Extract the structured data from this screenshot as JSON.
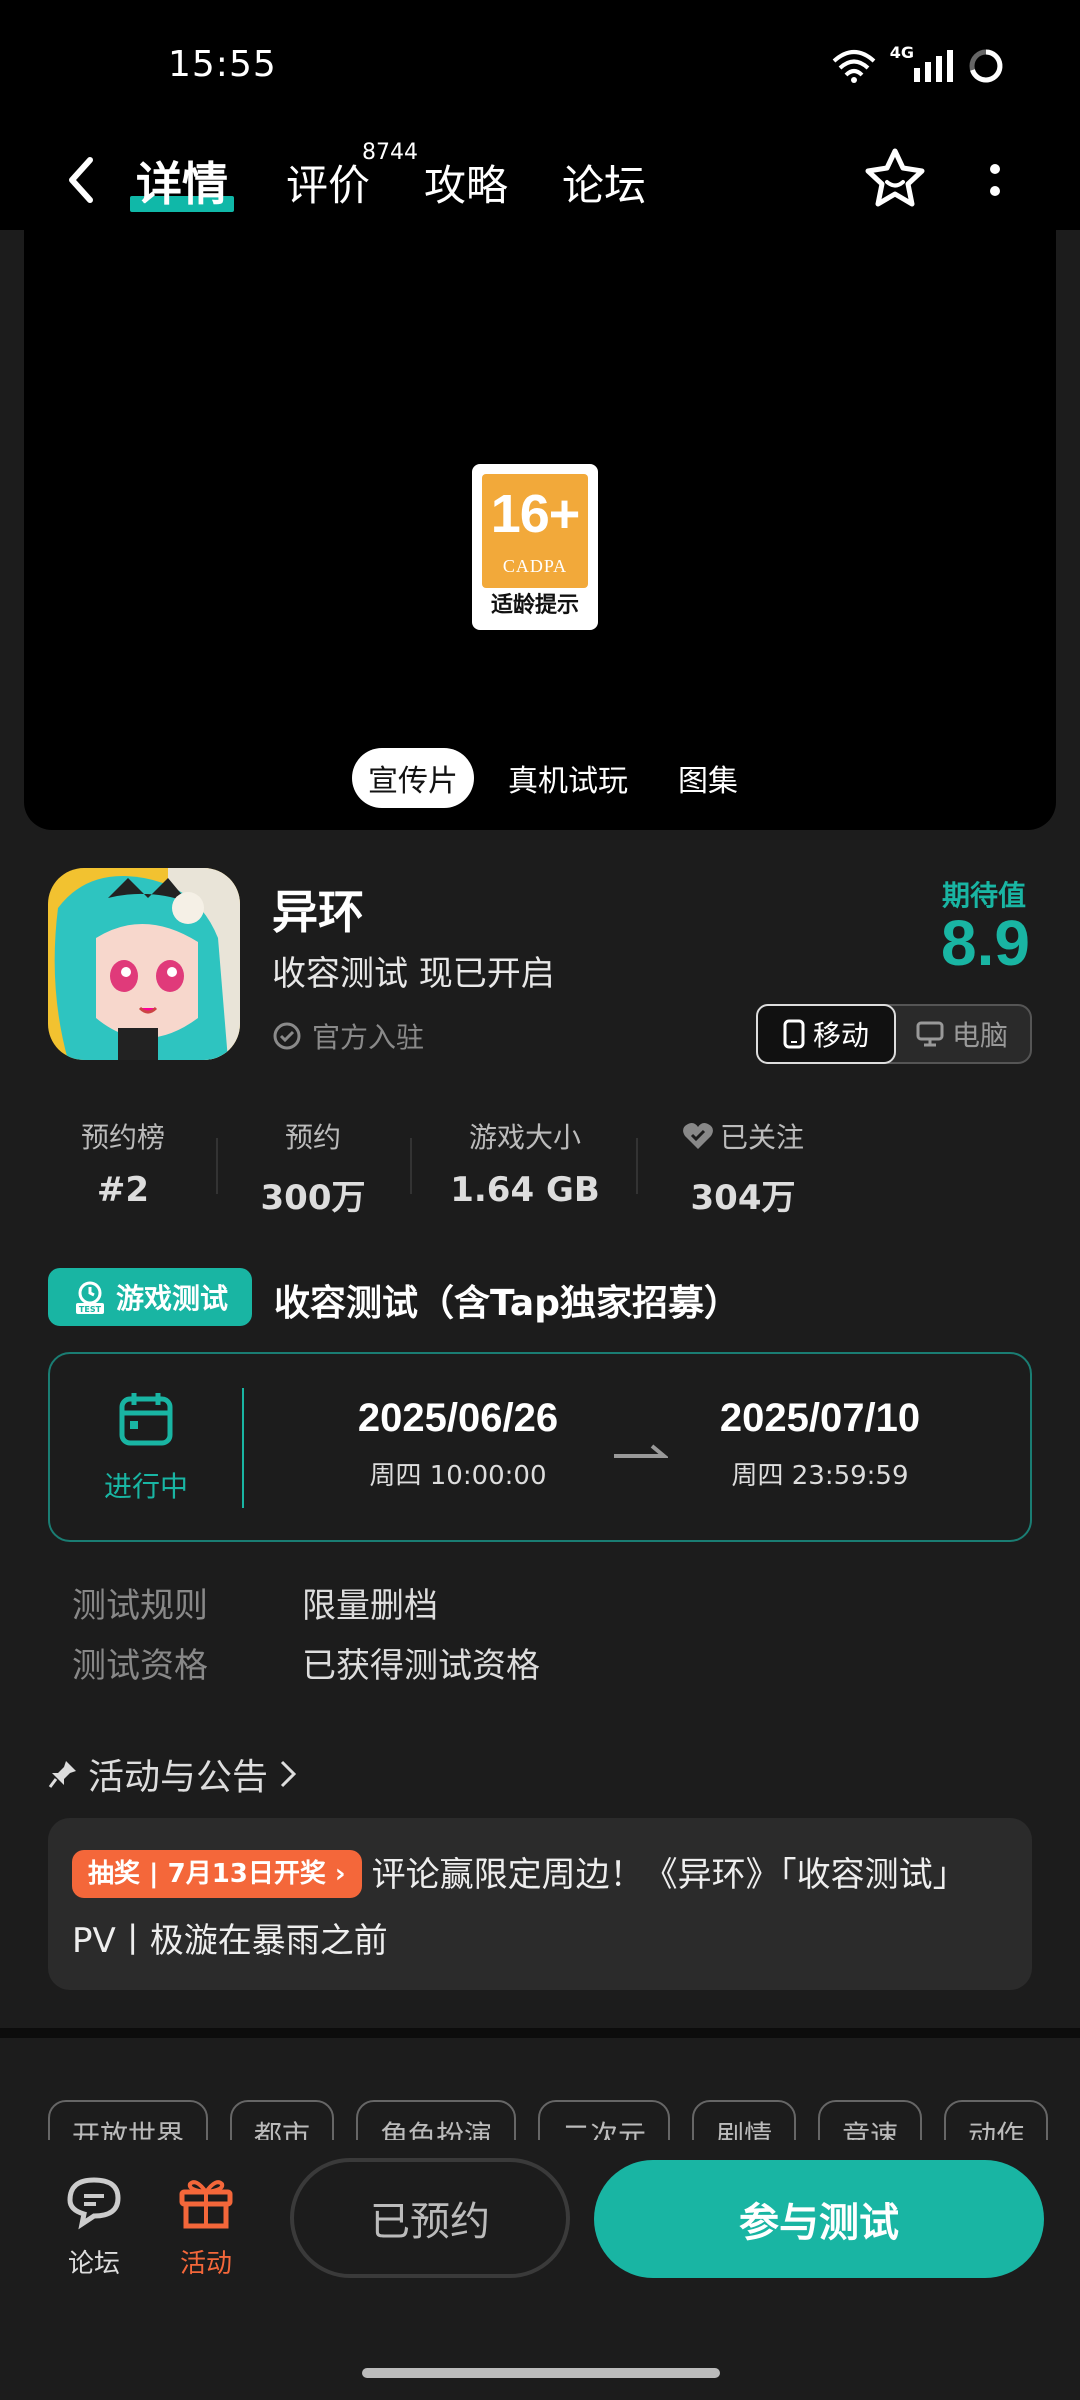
{
  "status": {
    "time": "15:55",
    "network": "4G"
  },
  "nav": {
    "tabs": {
      "details": "详情",
      "reviews": "评价",
      "guides": "攻略",
      "forum": "论坛"
    },
    "reviews_count": "8744"
  },
  "hero": {
    "age_badge": {
      "age": "16+",
      "org": "CADPA",
      "label": "适龄提示"
    },
    "media_tabs": [
      "宣传片",
      "真机试玩",
      "图集"
    ]
  },
  "game": {
    "name": "异环",
    "subtitle": "收容测试 现已开启",
    "official": "官方入驻",
    "rating_label": "期待值",
    "rating": "8.9",
    "platforms": [
      "移动",
      "电脑"
    ]
  },
  "stats": [
    {
      "label": "预约榜",
      "value": "#2"
    },
    {
      "label": "预约",
      "value": "300万"
    },
    {
      "label": "游戏大小",
      "value": "1.64 GB"
    },
    {
      "label": "已关注",
      "value": "304万"
    }
  ],
  "test": {
    "tag": "游戏测试",
    "title": "收容测试（含Tap独家招募）",
    "status": "进行中",
    "start_date": "2025/06/26",
    "start_time": "周四  10:00:00",
    "end_date": "2025/07/10",
    "end_time": "周四  23:59:59",
    "rules": [
      {
        "label": "测试规则",
        "value": "限量删档"
      },
      {
        "label": "测试资格",
        "value": "已获得测试资格"
      }
    ]
  },
  "announcements": {
    "header": "活动与公告",
    "pill": "抽奖 | 7月13日开奖 ›",
    "text": "评论赢限定周边！《异环》「收容测试」PV丨极漩在暴雨之前"
  },
  "genre_tags": [
    "开放世界",
    "都市",
    "角色扮演",
    "二次元",
    "剧情",
    "竞速",
    "动作"
  ],
  "bottom_bar": {
    "forum": "论坛",
    "activity": "活动",
    "reserved": "已预约",
    "join": "参与测试"
  },
  "colors": {
    "accent": "#19b5a3",
    "orange": "#f4673a",
    "background": "#1c1c1c"
  }
}
